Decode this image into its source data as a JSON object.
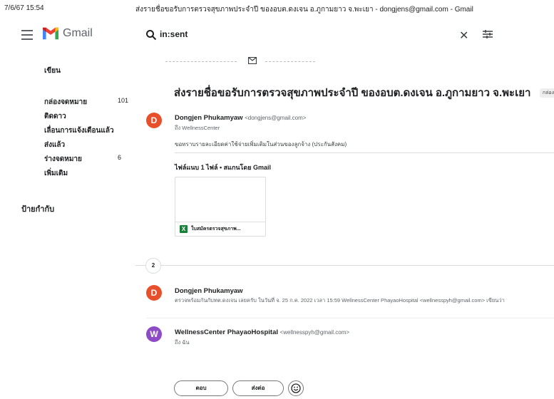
{
  "print_header": {
    "date": "7/6/67 15:54",
    "title": "ส่งรายชื่อขอรับการตรวจสุขภาพประจำปี ของอบต.ดงเจน อ.ภูกามยาว จ.พะเยา - dongjens@gmail.com - Gmail"
  },
  "topbar": {
    "app_name": "Gmail",
    "search_query": "in:sent"
  },
  "sidebar": {
    "compose_label": "เขียน",
    "items": [
      {
        "label": "กล่องจดหมาย",
        "count": "101"
      },
      {
        "label": "ติดดาว",
        "count": ""
      },
      {
        "label": "เลื่อนการแจ้งเตือนแล้ว",
        "count": ""
      },
      {
        "label": "ส่งแล้ว",
        "count": ""
      },
      {
        "label": "ร่างจดหมาย",
        "count": "6"
      },
      {
        "label": "เพิ่มเติม",
        "count": ""
      }
    ],
    "labels_title": "ป้ายกำกับ"
  },
  "thread": {
    "subject": "ส่งรายชื่อขอรับการตรวจสุขภาพประจำปี ของอบต.ดงเจน อ.ภูกามยาว จ.พะเยา",
    "inbox_chip": "กล่องจดหมาย ×",
    "collapsed_count": "2",
    "messages": [
      {
        "avatar": "D",
        "sender": "Dongjen Phukamyaw",
        "email": "<dongjens@gmail.com>",
        "to": "ถึง WellnessCenter",
        "body": "ขอทราบรายละเอียดค่าใช้จ่ายเพิ่มเติมในส่วนของลูกจ้าง (ประกันสังคม)",
        "attachments_title": "ไฟล์แนบ 1 ไฟล์  •  สแกนโดย Gmail",
        "attachment": {
          "icon": "X",
          "name": "ใบสมัครตรวจสุขภาพ..."
        }
      },
      {
        "avatar": "D",
        "sender": "Dongjen Phukamyaw",
        "snippet": "ตรวจพร้อมกันกับทต.ดงเจน เลยครับ ในวันที่ จ. 25 ก.ค. 2022 เวลา 15:59 WellnessCenter PhayaoHospital <wellnesspyh@gmail.com> เขียนว่า"
      },
      {
        "avatar": "W",
        "sender": "WellnessCenter PhayaoHospital",
        "email": "<wellnesspyh@gmail.com>",
        "to": "ถึง ฉัน"
      }
    ]
  },
  "actions": {
    "reply": "ตอบ",
    "forward": "ส่งต่อ"
  },
  "colors": {
    "avatar_d": "#e8502c",
    "avatar_w": "#8d4cc6",
    "excel_green": "#188038"
  }
}
